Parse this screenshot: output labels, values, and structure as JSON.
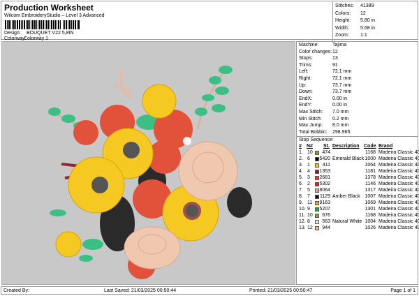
{
  "header": {
    "title": "Production Worksheet",
    "subtitle": "Wilcom EmbroideryStudio – Level 3 Advanced",
    "design_label": "Design:",
    "design_value": "BOUQUET V22 5,8IN",
    "colorway_label": "Colorway:",
    "colorway_value": "Colorway 1"
  },
  "stats": [
    {
      "label": "Stitches:",
      "value": "41389"
    },
    {
      "label": "Colors:",
      "value": "12"
    },
    {
      "label": "Height:",
      "value": "5.80 in"
    },
    {
      "label": "Width:",
      "value": "5.68 in"
    },
    {
      "label": "Zoom:",
      "value": "1:1"
    }
  ],
  "properties": [
    {
      "label": "Machine:",
      "value": "Tajima"
    },
    {
      "label": "Color changes:",
      "value": "12"
    },
    {
      "label": "Stops:",
      "value": "13"
    },
    {
      "label": "Trims:",
      "value": "91"
    },
    {
      "label": "Left:",
      "value": "72.1 mm"
    },
    {
      "label": "Right:",
      "value": "72.1 mm"
    },
    {
      "label": "Up:",
      "value": "73.7 mm"
    },
    {
      "label": "Down:",
      "value": "73.7 mm"
    },
    {
      "label": "EndX:",
      "value": "0.00 in"
    },
    {
      "label": "EndY:",
      "value": "0.00 in"
    },
    {
      "label": "Max Stitch:",
      "value": "7.0 mm"
    },
    {
      "label": "Min Stitch:",
      "value": "0.2 mm"
    },
    {
      "label": "Max Jump:",
      "value": "8.0 mm"
    },
    {
      "label": "Total Bobbin:",
      "value": "298.96ft"
    }
  ],
  "stop_sequence": {
    "label": "Stop Sequence:",
    "headers": [
      "#",
      "N#",
      "St.",
      "Description",
      "Code",
      "Brand"
    ],
    "rows": [
      {
        "n": "1.",
        "needle": "10",
        "color": "#8ca040",
        "st": "474",
        "desc": "",
        "code": "1168",
        "brand": "Madeira Classic 40"
      },
      {
        "n": "2.",
        "needle": "6",
        "color": "#000000",
        "st": "5420",
        "desc": "Emerald Black",
        "code": "1000",
        "brand": "Madeira Classic 40"
      },
      {
        "n": "3.",
        "needle": "1",
        "color": "#f5c400",
        "st": "411",
        "desc": "",
        "code": "1064",
        "brand": "Madeira Classic 40"
      },
      {
        "n": "4.",
        "needle": "4",
        "color": "#8b1a30",
        "st": "1353",
        "desc": "",
        "code": "1181",
        "brand": "Madeira Classic 40"
      },
      {
        "n": "5.",
        "needle": "3",
        "color": "#e8461e",
        "st": "2681",
        "desc": "",
        "code": "1378",
        "brand": "Madeira Classic 40"
      },
      {
        "n": "6.",
        "needle": "2",
        "color": "#d42020",
        "st": "5302",
        "desc": "",
        "code": "1146",
        "brand": "Madeira Classic 40"
      },
      {
        "n": "7.",
        "needle": "5",
        "color": "#e8a0a0",
        "st": "8064",
        "desc": "",
        "code": "1317",
        "brand": "Madeira Classic 40"
      },
      {
        "n": "8.",
        "needle": "7",
        "color": "#111111",
        "st": "1129",
        "desc": "Amber Black",
        "code": "1007",
        "brand": "Madeira Classic 40"
      },
      {
        "n": "9.",
        "needle": "11",
        "color": "#f0a800",
        "st": "9163",
        "desc": "",
        "code": "1069",
        "brand": "Madeira Classic 40"
      },
      {
        "n": "10.",
        "needle": "9",
        "color": "#20a068",
        "st": "5207",
        "desc": "",
        "code": "1301",
        "brand": "Madeira Classic 40"
      },
      {
        "n": "11.",
        "needle": "10",
        "color": "#8ca040",
        "st": "676",
        "desc": "",
        "code": "1168",
        "brand": "Madeira Classic 40"
      },
      {
        "n": "12.",
        "needle": "8",
        "color": "#e8e8f0",
        "st": "563",
        "desc": "Natural White",
        "code": "1004",
        "brand": "Madeira Classic 40"
      },
      {
        "n": "13.",
        "needle": "12",
        "color": "#f0b888",
        "st": "944",
        "desc": "",
        "code": "1026",
        "brand": "Madeira Classic 40"
      }
    ]
  },
  "footer": {
    "created_by": "Created By:",
    "last_saved": "Last Saved: 21/03/2025 00:50:44",
    "printed": "Printed: 21/03/2025 00:50:47",
    "page": "Page 1 of 1"
  }
}
